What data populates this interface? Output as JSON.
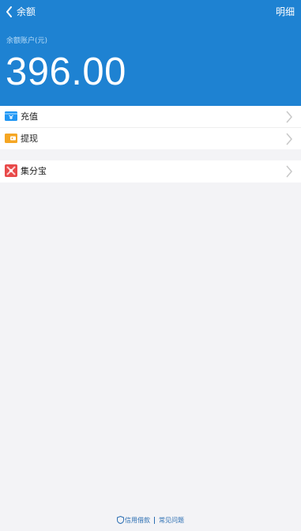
{
  "header": {
    "title": "余额",
    "detail_label": "明细",
    "back_icon": "chevron-left-icon",
    "background_color": "#1e82d2"
  },
  "balance": {
    "label": "余额账户(元)",
    "amount": "396.00"
  },
  "menu_group_1": [
    {
      "label": "充值",
      "icon": "recharge-icon",
      "icon_color": "#2196f3"
    },
    {
      "label": "提现",
      "icon": "withdraw-icon",
      "icon_color": "#f5a623"
    }
  ],
  "menu_group_2": [
    {
      "label": "集分宝",
      "icon": "jifenbao-icon",
      "icon_color": "#e84a4a"
    }
  ],
  "footer": {
    "security_label": "信用借款",
    "faq_label": "常见问题"
  }
}
